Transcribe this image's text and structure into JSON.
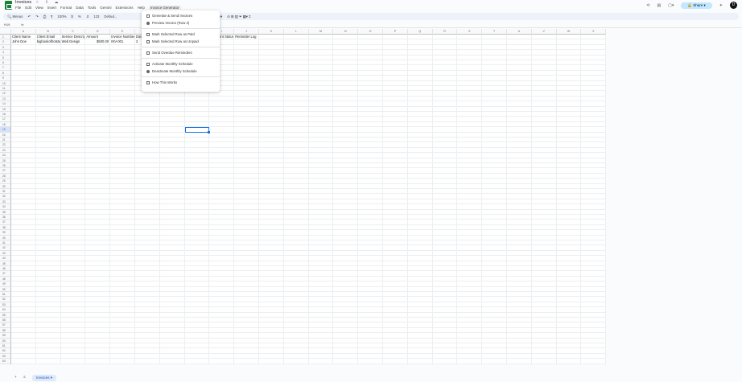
{
  "doc": {
    "title": "Invoices",
    "menus": [
      "File",
      "Edit",
      "View",
      "Insert",
      "Format",
      "Data",
      "Tools",
      "Gemini",
      "Extensions",
      "Help",
      "Invoice Generator"
    ]
  },
  "toolbar": {
    "search": "Menus",
    "zoom": "100%",
    "currency": "$",
    "percent": "%",
    "font": "Defaul..."
  },
  "formula": {
    "cell_ref": "H19",
    "fx": "fx"
  },
  "header_right": {
    "share": "Share",
    "avatar": "D"
  },
  "columns": [
    "A",
    "B",
    "C",
    "D",
    "E",
    "F",
    "G",
    "H",
    "I",
    "J",
    "K",
    "L",
    "M",
    "N",
    "O",
    "P",
    "Q",
    "R",
    "S",
    "T",
    "U",
    "V",
    "W",
    "X"
  ],
  "rows": [
    [
      "Client Name",
      "Client Email",
      "Service Description",
      "Amount",
      "Invoice Number",
      "Date",
      "",
      "",
      "Payment Status",
      "Reminder Log"
    ],
    [
      "John Doe",
      "bigbookofhotstuff",
      "Web Design",
      "$500.00",
      "INV-001",
      "2",
      "",
      "",
      "",
      ""
    ]
  ],
  "row_count": 64,
  "selected": {
    "row": 19,
    "col": 7
  },
  "menu": {
    "items": [
      {
        "label": "Generate & Send Invoices",
        "icon": "document-icon"
      },
      {
        "label": "Preview Invoice (Row 2)",
        "icon": "eye-icon"
      },
      {
        "sep": true
      },
      {
        "label": "Mark Selected Row as Paid",
        "icon": "checkbox-icon"
      },
      {
        "label": "Mark Selected Row as Unpaid",
        "icon": "checkbox-icon"
      },
      {
        "sep": true
      },
      {
        "label": "Send Overdue Reminders",
        "icon": "alarm-icon"
      },
      {
        "sep": true
      },
      {
        "label": "Activate Monthly Schedule",
        "icon": "clock-icon"
      },
      {
        "label": "Deactivate Monthly Schedule",
        "icon": "stop-icon"
      },
      {
        "sep": true
      },
      {
        "label": "How This Works",
        "icon": "info-icon"
      }
    ]
  },
  "sheets": {
    "active": "Invoices"
  }
}
